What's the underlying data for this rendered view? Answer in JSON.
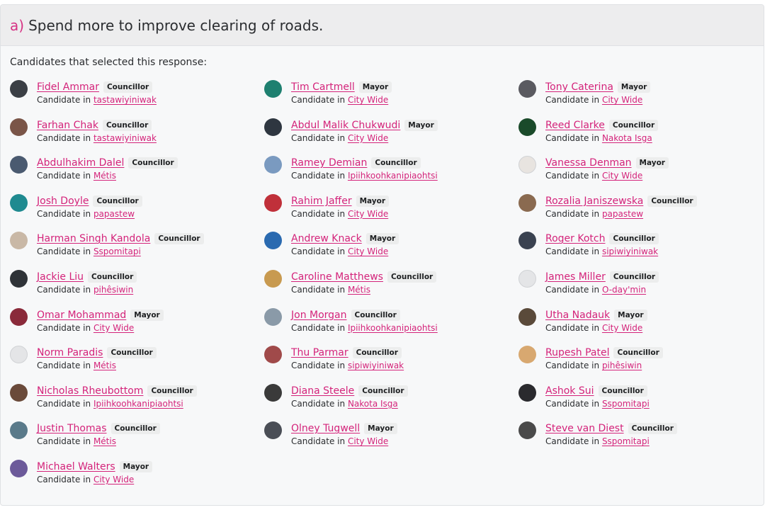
{
  "question": {
    "letter": "a)",
    "text": "Spend more to improve clearing of roads."
  },
  "intro": "Candidates that selected this response:",
  "candidate_prefix": "Candidate in",
  "columns": [
    [
      {
        "name": "Fidel Ammar",
        "role": "Councillor",
        "ward": "tastawiyiniwak",
        "avatar_color": "#3b3f45"
      },
      {
        "name": "Farhan Chak",
        "role": "Councillor",
        "ward": "tastawiyiniwak",
        "avatar_color": "#7a5548"
      },
      {
        "name": "Abdulhakim Dalel",
        "role": "Councillor",
        "ward": "Métis",
        "avatar_color": "#4a5a70"
      },
      {
        "name": "Josh Doyle",
        "role": "Councillor",
        "ward": "papastew",
        "avatar_color": "#1f8a90"
      },
      {
        "name": "Harman Singh Kandola",
        "role": "Councillor",
        "ward": "Sspomitapi",
        "avatar_color": "#c9b8a6"
      },
      {
        "name": "Jackie Liu",
        "role": "Councillor",
        "ward": "pihêsiwin",
        "avatar_color": "#2f3338"
      },
      {
        "name": "Omar Mohammad",
        "role": "Mayor",
        "ward": "City Wide",
        "avatar_color": "#8a2a3a"
      },
      {
        "name": "Norm Paradis",
        "role": "Councillor",
        "ward": "Métis",
        "avatar_color": "#e4e5e7"
      },
      {
        "name": "Nicholas Rheubottom",
        "role": "Councillor",
        "ward": "Ipiihkoohkanipiaohtsi",
        "avatar_color": "#6a4a3a"
      },
      {
        "name": "Justin Thomas",
        "role": "Councillor",
        "ward": "Métis",
        "avatar_color": "#5a7a8a"
      },
      {
        "name": "Michael Walters",
        "role": "Mayor",
        "ward": "City Wide",
        "avatar_color": "#6c5a9a"
      }
    ],
    [
      {
        "name": "Tim Cartmell",
        "role": "Mayor",
        "ward": "City Wide",
        "avatar_color": "#1e8070"
      },
      {
        "name": "Abdul Malik Chukwudi",
        "role": "Mayor",
        "ward": "City Wide",
        "avatar_color": "#2e3640"
      },
      {
        "name": "Ramey Demian",
        "role": "Councillor",
        "ward": "Ipiihkoohkanipiaohtsi",
        "avatar_color": "#7a9ac0"
      },
      {
        "name": "Rahim Jaffer",
        "role": "Mayor",
        "ward": "City Wide",
        "avatar_color": "#c0303a"
      },
      {
        "name": "Andrew Knack",
        "role": "Mayor",
        "ward": "City Wide",
        "avatar_color": "#2a6ab0"
      },
      {
        "name": "Caroline Matthews",
        "role": "Councillor",
        "ward": "Métis",
        "avatar_color": "#c89a50"
      },
      {
        "name": "Jon Morgan",
        "role": "Councillor",
        "ward": "Ipiihkoohkanipiaohtsi",
        "avatar_color": "#8a9aa8"
      },
      {
        "name": "Thu Parmar",
        "role": "Councillor",
        "ward": "sipiwiyiniwak",
        "avatar_color": "#a04a4a"
      },
      {
        "name": "Diana Steele",
        "role": "Councillor",
        "ward": "Nakota Isga",
        "avatar_color": "#3a3a3a"
      },
      {
        "name": "Olney Tugwell",
        "role": "Mayor",
        "ward": "City Wide",
        "avatar_color": "#4a4e56"
      }
    ],
    [
      {
        "name": "Tony Caterina",
        "role": "Mayor",
        "ward": "City Wide",
        "avatar_color": "#5a5a60"
      },
      {
        "name": "Reed Clarke",
        "role": "Councillor",
        "ward": "Nakota Isga",
        "avatar_color": "#1a4a2a"
      },
      {
        "name": "Vanessa Denman",
        "role": "Mayor",
        "ward": "City Wide",
        "avatar_color": "#e8e4e0"
      },
      {
        "name": "Rozalia Janiszewska",
        "role": "Councillor",
        "ward": "papastew",
        "avatar_color": "#8a6a50"
      },
      {
        "name": "Roger Kotch",
        "role": "Councillor",
        "ward": "sipiwiyiniwak",
        "avatar_color": "#3a4250"
      },
      {
        "name": "James Miller",
        "role": "Councillor",
        "ward": "O-day'min",
        "avatar_color": "#e4e5e7"
      },
      {
        "name": "Utha Nadauk",
        "role": "Mayor",
        "ward": "City Wide",
        "avatar_color": "#5a4a3a"
      },
      {
        "name": "Rupesh Patel",
        "role": "Councillor",
        "ward": "pihêsiwin",
        "avatar_color": "#d8a870"
      },
      {
        "name": "Ashok Sui",
        "role": "Councillor",
        "ward": "Sspomitapi",
        "avatar_color": "#2a2a2e"
      },
      {
        "name": "Steve van Diest",
        "role": "Councillor",
        "ward": "Sspomitapi",
        "avatar_color": "#4a4a4a"
      }
    ]
  ]
}
